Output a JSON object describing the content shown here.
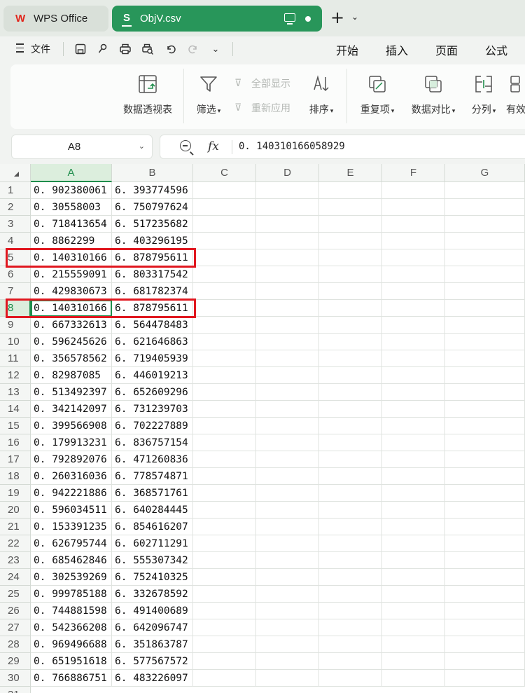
{
  "tabbar": {
    "home_tab": "WPS Office",
    "doc_tab": "ObjV.csv",
    "doc_icon_letter": "S"
  },
  "menu": {
    "file": "文件",
    "tabs": [
      "开始",
      "插入",
      "页面",
      "公式"
    ]
  },
  "ribbon": {
    "pivot": "数据透视表",
    "filter": "筛选",
    "show_all": "全部显示",
    "reapply": "重新应用",
    "sort": "排序",
    "duplicates": "重复项",
    "compare": "数据对比",
    "split": "分列",
    "valid": "有效"
  },
  "formula_bar": {
    "name_box": "A8",
    "fx": "fx",
    "value": "0. 140310166058929"
  },
  "sheet": {
    "columns": [
      "A",
      "B",
      "C",
      "D",
      "E",
      "F",
      "G"
    ],
    "active_column": "A",
    "active_row": 8,
    "rows": [
      [
        "0. 902380061",
        "6. 393774596"
      ],
      [
        "0. 30558003",
        "6. 750797624"
      ],
      [
        "0. 718413654",
        "6. 517235682"
      ],
      [
        "0. 8862299",
        "6. 403296195"
      ],
      [
        "0. 140310166",
        "6. 878795611"
      ],
      [
        "0. 215559091",
        "6. 803317542"
      ],
      [
        "0. 429830673",
        "6. 681782374"
      ],
      [
        "0. 140310166",
        "6. 878795611"
      ],
      [
        "0. 667332613",
        "6. 564478483"
      ],
      [
        "0. 596245626",
        "6. 621646863"
      ],
      [
        "0. 356578562",
        "6. 719405939"
      ],
      [
        "0. 82987085",
        "6. 446019213"
      ],
      [
        "0. 513492397",
        "6. 652609296"
      ],
      [
        "0. 342142097",
        "6. 731239703"
      ],
      [
        "0. 399566908",
        "6. 702227889"
      ],
      [
        "0. 179913231",
        "6. 836757154"
      ],
      [
        "0. 792892076",
        "6. 471260836"
      ],
      [
        "0. 260316036",
        "6. 778574871"
      ],
      [
        "0. 942221886",
        "6. 368571761"
      ],
      [
        "0. 596034511",
        "6. 640284445"
      ],
      [
        "0. 153391235",
        "6. 854616207"
      ],
      [
        "0. 626795744",
        "6. 602711291"
      ],
      [
        "0. 685462846",
        "6. 555307342"
      ],
      [
        "0. 302539269",
        "6. 752410325"
      ],
      [
        "0. 999785188",
        "6. 332678592"
      ],
      [
        "0. 744881598",
        "6. 491400689"
      ],
      [
        "0. 542366208",
        "6. 642096747"
      ],
      [
        "0. 969496688",
        "6. 351863787"
      ],
      [
        "0. 651951618",
        "6. 577567572"
      ],
      [
        "0. 766886751",
        "6. 483226097"
      ]
    ],
    "highlighted_rows": [
      5,
      8
    ],
    "colors": {
      "accent_green": "#1f8d4c",
      "tab_green": "#28965a",
      "highlight_red": "#e0171f"
    }
  }
}
